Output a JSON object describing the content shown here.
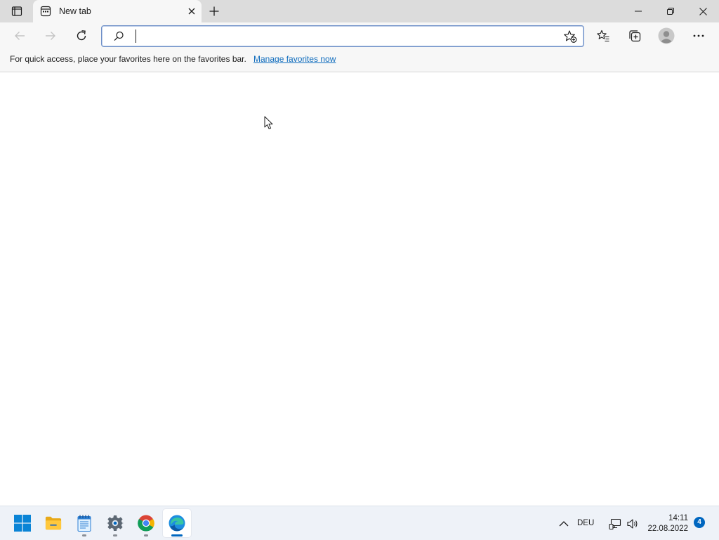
{
  "browser": {
    "tab": {
      "title": "New tab"
    },
    "address_bar": {
      "value": "",
      "placeholder": ""
    },
    "favorites_bar": {
      "message": "For quick access, place your favorites here on the favorites bar.",
      "link": "Manage favorites now"
    },
    "icons": {
      "tab_actions": "tab-actions-icon",
      "favicon": "new-tab-page-icon",
      "close_tab": "close-icon",
      "new_tab": "plus-icon",
      "minimize": "minimize-icon",
      "restore": "restore-icon",
      "close_window": "close-icon",
      "back": "arrow-left-icon",
      "forward": "arrow-right-icon",
      "reload": "reload-icon",
      "search": "search-icon",
      "add_favorite": "star-add-icon",
      "favorites": "favorites-list-icon",
      "collections": "collections-icon",
      "profile": "profile-avatar-icon",
      "menu": "more-dots-icon"
    }
  },
  "taskbar": {
    "apps": [
      {
        "name": "Start",
        "icon": "windows-logo-icon",
        "running": false
      },
      {
        "name": "File Explorer",
        "icon": "folder-icon",
        "running": false
      },
      {
        "name": "Notepad",
        "icon": "notepad-icon",
        "running": true
      },
      {
        "name": "Settings",
        "icon": "gear-icon",
        "running": true
      },
      {
        "name": "Google Chrome",
        "icon": "chrome-icon",
        "running": true
      },
      {
        "name": "Microsoft Edge",
        "icon": "edge-icon",
        "running": true,
        "active": true
      }
    ],
    "tray": {
      "language": "DEU",
      "time": "14:11",
      "date": "22.08.2022",
      "notifications": "4"
    }
  },
  "colors": {
    "titlebar": "#dcdcdc",
    "toolbar": "#f7f7f7",
    "link": "#0f6cbd",
    "accent": "#0067c0",
    "taskbar": "#eef2f8"
  }
}
